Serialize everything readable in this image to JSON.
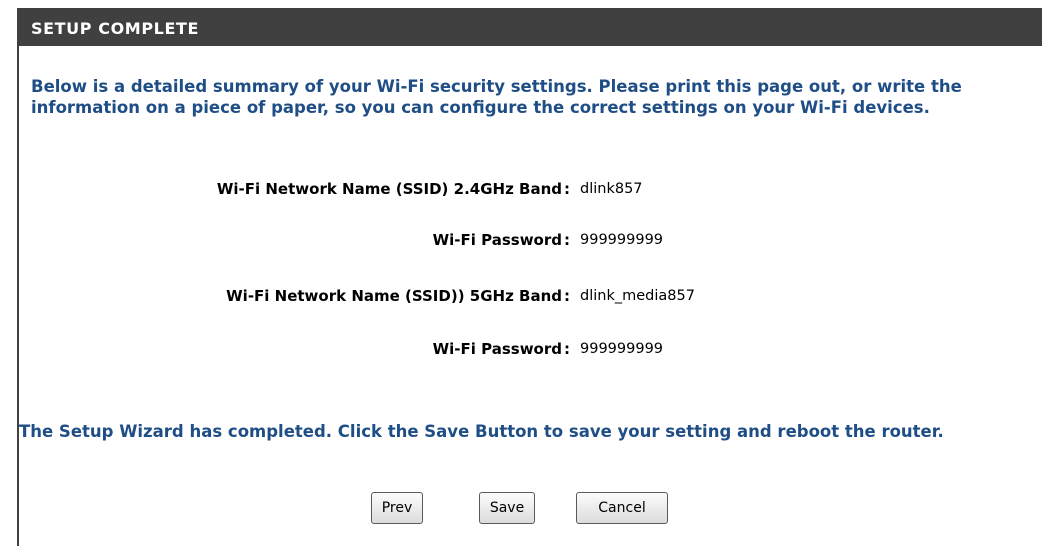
{
  "header": {
    "title": "SETUP COMPLETE"
  },
  "intro_text": "Below is a detailed summary of your Wi-Fi security settings. Please print this page out, or write the information on a piece of paper, so you can configure the correct settings on your Wi-Fi devices.",
  "settings": [
    {
      "label": "Wi-Fi Network Name (SSID) 2.4GHz Band",
      "value": "dlink857"
    },
    {
      "label": "Wi-Fi Password",
      "value": "999999999"
    },
    {
      "label": "Wi-Fi Network Name (SSID)) 5GHz Band",
      "value": "dlink_media857"
    },
    {
      "label": "Wi-Fi Password",
      "value": "999999999"
    }
  ],
  "separator": ":",
  "completion_text": "The Setup Wizard has completed. Click the Save Button to save your setting and reboot the router.",
  "buttons": {
    "prev": "Prev",
    "save": "Save",
    "cancel": "Cancel"
  },
  "colors": {
    "header_bg": "#404040",
    "header_text": "#ffffff",
    "info_text": "#1f4e86"
  }
}
